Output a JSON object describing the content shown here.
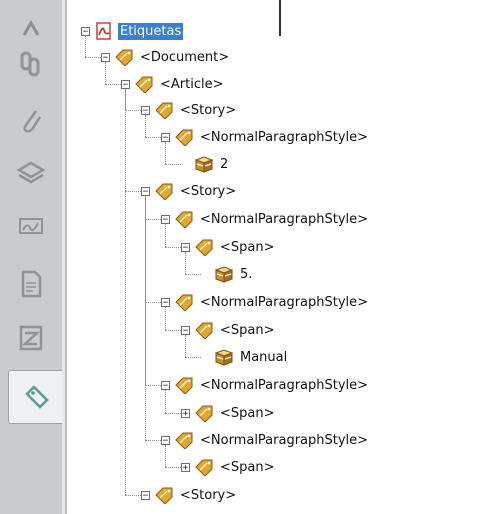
{
  "rail": {
    "buttons": [
      {
        "icon": "link-icon"
      },
      {
        "icon": "attachment-icon"
      },
      {
        "icon": "layers-icon"
      },
      {
        "icon": "signature-icon"
      },
      {
        "icon": "page-icon"
      },
      {
        "icon": "content-icon"
      },
      {
        "icon": "tag-icon",
        "active": true
      }
    ]
  },
  "tree": {
    "root_label": "Etiquetas",
    "nodes": [
      {
        "label": "<Document>",
        "type": "tag",
        "toggle": "−"
      },
      {
        "label": "<Article>",
        "type": "tag",
        "toggle": "−"
      },
      {
        "label": "<Story>",
        "type": "tag",
        "toggle": "−"
      },
      {
        "label": "<NormalParagraphStyle>",
        "type": "tag",
        "toggle": "−"
      },
      {
        "label": "2",
        "type": "content",
        "toggle": ""
      },
      {
        "label": "<Story>",
        "type": "tag",
        "toggle": "−"
      },
      {
        "label": "<NormalParagraphStyle>",
        "type": "tag",
        "toggle": "−"
      },
      {
        "label": "<Span>",
        "type": "tag",
        "toggle": "−"
      },
      {
        "label": "5.",
        "type": "content",
        "toggle": ""
      },
      {
        "label": "<NormalParagraphStyle>",
        "type": "tag",
        "toggle": "−"
      },
      {
        "label": "<Span>",
        "type": "tag",
        "toggle": "−"
      },
      {
        "label": "Manual",
        "type": "content",
        "toggle": ""
      },
      {
        "label": "<NormalParagraphStyle>",
        "type": "tag",
        "toggle": "−"
      },
      {
        "label": "<Span>",
        "type": "tag",
        "toggle": "+"
      },
      {
        "label": "<NormalParagraphStyle>",
        "type": "tag",
        "toggle": "−"
      },
      {
        "label": "<Span>",
        "type": "tag",
        "toggle": "+"
      },
      {
        "label": "<Story>",
        "type": "tag",
        "toggle": "−"
      }
    ]
  },
  "colors": {
    "selection": "#3b7fd0",
    "tag_icon": "#e0a82e",
    "rail_bg": "#c9cccf",
    "pdf_red": "#d8261c"
  }
}
